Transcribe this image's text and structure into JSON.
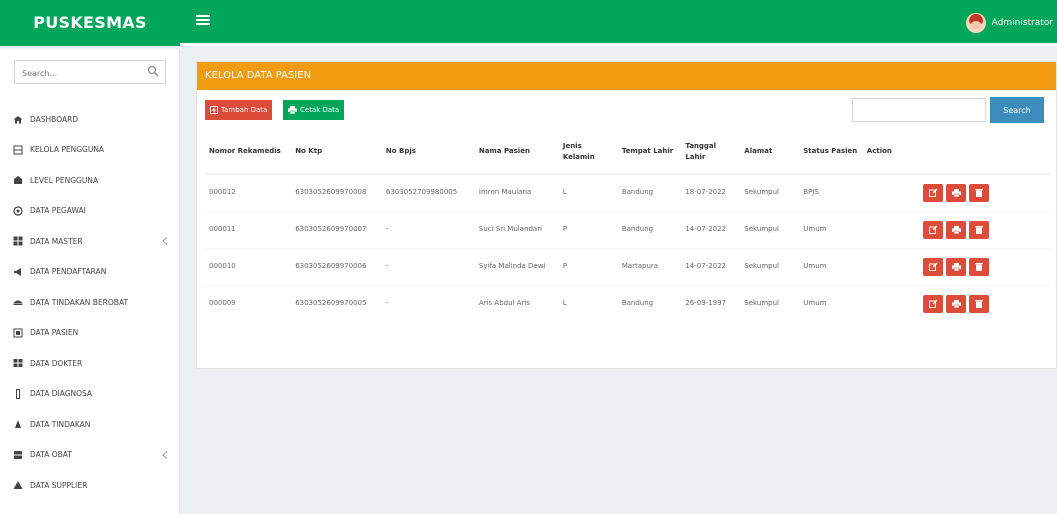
{
  "header": {
    "brand": "PUSKESMAS",
    "user": "Administrator"
  },
  "sidebar": {
    "search_placeholder": "Search...",
    "items": [
      {
        "label": "DASHBOARD",
        "icon": "dashboard-icon"
      },
      {
        "label": "KELOLA PENGGUNA",
        "icon": "users-icon"
      },
      {
        "label": "LEVEL PENGGUNA",
        "icon": "level-icon"
      },
      {
        "label": "DATA PEGAWAI",
        "icon": "employee-icon"
      },
      {
        "label": "DATA MASTER",
        "icon": "grid-icon",
        "chevron": true
      },
      {
        "label": "DATA PENDAFTARAN",
        "icon": "bullhorn-icon"
      },
      {
        "label": "DATA TINDAKAN BEROBAT",
        "icon": "treatment-icon"
      },
      {
        "label": "DATA PASIEN",
        "icon": "patient-icon"
      },
      {
        "label": "DATA DOKTER",
        "icon": "doctor-icon"
      },
      {
        "label": "DATA DIAGNOSA",
        "icon": "diagnosis-icon"
      },
      {
        "label": "DATA TINDAKAN",
        "icon": "action-icon"
      },
      {
        "label": "DATA OBAT",
        "icon": "medicine-icon",
        "chevron": true
      },
      {
        "label": "DATA SUPPLIER",
        "icon": "supplier-icon"
      }
    ]
  },
  "main": {
    "title": "KELOLA DATA PASIEN",
    "add_label": "Tambah Data",
    "print_label": "Cetak Data",
    "search_button": "Search",
    "columns": [
      "Nomor Rekamedis",
      "No Ktp",
      "No Bpjs",
      "Nama Pasien",
      "Jenis Kelamin",
      "Tempat Lahir",
      "Tanggal Lahir",
      "Alamat",
      "Status Pasien",
      "Action"
    ],
    "rows": [
      [
        "000012",
        "6303052609970008",
        "6303052709980005",
        "Imron Maulana",
        "L",
        "Bandung",
        "18-07-2022",
        "Sekumpul",
        "BPJS"
      ],
      [
        "000011",
        "6303052609970007",
        "-",
        "Suci Sri Mulandari",
        "P",
        "Bandung",
        "14-07-2022",
        "Sekumpul",
        "Umum"
      ],
      [
        "000010",
        "6303052609970006",
        "-",
        "Syifa Malinda Dewi",
        "P",
        "Martapura",
        "14-07-2022",
        "Sekumpul",
        "Umum"
      ],
      [
        "000009",
        "6303052609970005",
        "-",
        "Aris Abdul Aris",
        "L",
        "Bandung",
        "26-09-1997",
        "Sekumpul",
        "Umum"
      ]
    ]
  },
  "colors": {
    "primary": "#00a65a",
    "header": "#f39c12",
    "danger": "#dd4b39",
    "info": "#3c8dbc"
  }
}
